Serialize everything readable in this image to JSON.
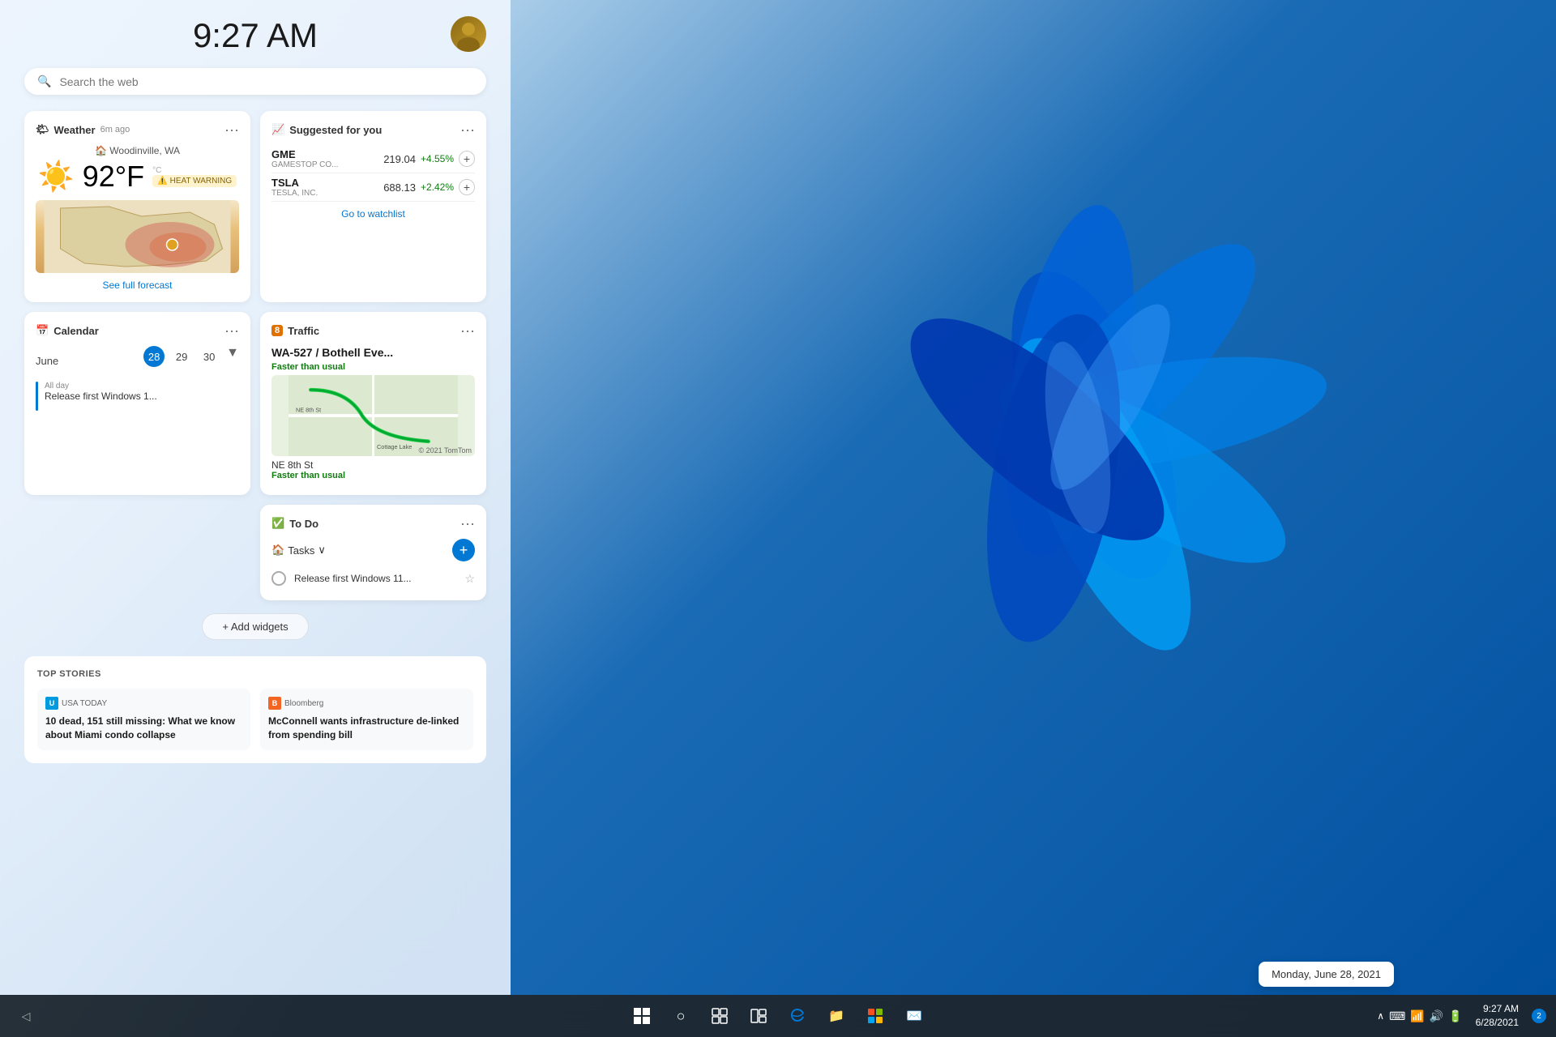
{
  "time": "9:27 AM",
  "search": {
    "placeholder": "Search the web"
  },
  "weather": {
    "title": "Weather",
    "timestamp": "6m ago",
    "location": "Woodinville, WA",
    "temperature": "92",
    "unit": "°F",
    "unit2": "°C",
    "alert": "HEAT WARNING",
    "forecast_link": "See full forecast",
    "icon": "☀️"
  },
  "stocks": {
    "title": "Suggested for you",
    "gme_ticker": "GME",
    "gme_name": "GAMESTOP CO...",
    "gme_price": "219.04",
    "gme_change": "+4.55%",
    "tsla_ticker": "TSLA",
    "tsla_name": "TESLA, INC.",
    "tsla_price": "688.13",
    "tsla_change": "+2.42%",
    "watchlist_link": "Go to watchlist"
  },
  "traffic": {
    "title": "Traffic",
    "route": "WA-527 / Bothell Eve...",
    "status1": "Faster than usual",
    "road2": "NE 8th St",
    "status2": "Faster than usual",
    "location": "Cottage Lake",
    "copyright": "© 2021 TomTom"
  },
  "calendar": {
    "title": "Calendar",
    "month": "June",
    "days": [
      "28",
      "29",
      "30"
    ],
    "today_index": 0,
    "allday": "All day",
    "event_title": "Release first Windows 1..."
  },
  "todo": {
    "title": "To Do",
    "tasks_label": "Tasks",
    "task_title": "Release first Windows 11...",
    "flag_icon": "🏳️"
  },
  "add_widgets_label": "+ Add widgets",
  "top_stories": {
    "title": "TOP STORIES",
    "story1_source": "USA TODAY",
    "story1_headline": "10 dead, 151 still missing: What we know about Miami condo collapse",
    "story2_source": "Bloomberg",
    "story2_headline": "McConnell wants infrastructure de-linked from spending bill"
  },
  "taskbar": {
    "time": "9:27 AM",
    "date": "6/28/2021",
    "tooltip_date": "Monday, June 28, 2021",
    "notification_count": "2"
  },
  "icons": {
    "search": "🔍",
    "windows": "⊞",
    "search_taskbar": "○",
    "widgets": "▦",
    "calendar_icon": "📅",
    "todo_icon": "✓",
    "weather_icon": "🌤",
    "stocks_icon": "📈",
    "traffic_icon": "8"
  }
}
